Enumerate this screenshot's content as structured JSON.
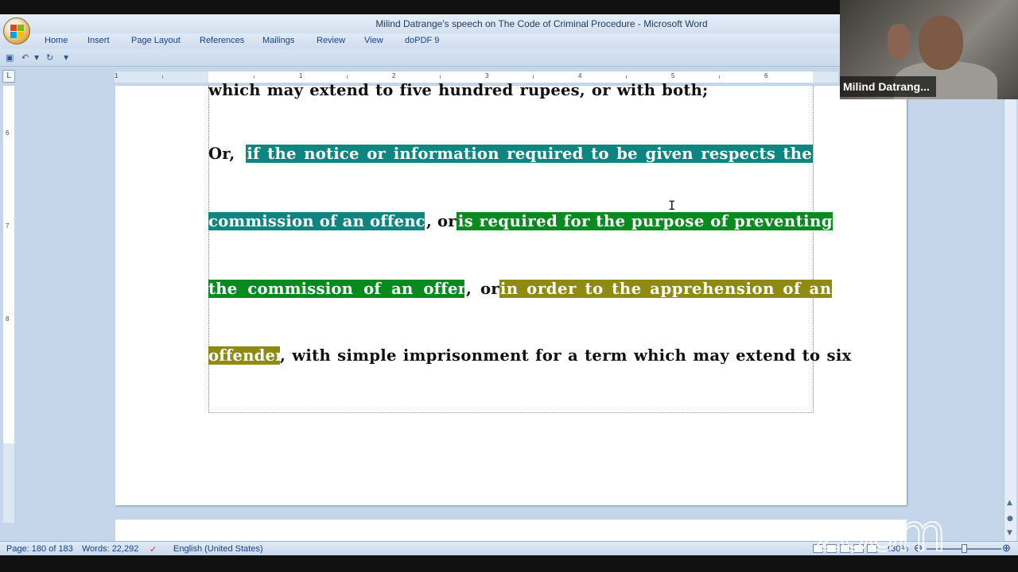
{
  "window": {
    "title": "Milind Datrange's speech on The Code of Criminal Procedure - Microsoft Word"
  },
  "ribbon": {
    "tabs": [
      "Home",
      "Insert",
      "Page Layout",
      "References",
      "Mailings",
      "Review",
      "View",
      "doPDF 9"
    ]
  },
  "ruler": {
    "numbers": [
      "1",
      "1",
      "2",
      "3",
      "4",
      "5",
      "6"
    ],
    "vnumbers": [
      "6",
      "7",
      "8"
    ]
  },
  "document": {
    "line1": "which may extend to five hundred rupees, or with both;",
    "line2_prefix": "Or,",
    "line2_words": [
      "if",
      "the",
      "notice",
      "or",
      "information",
      "required",
      "to",
      "be",
      "given",
      "respects",
      "the"
    ],
    "line3_teal": "commission of an offence",
    "line3_mid": ", or",
    "line3_green": "is required for the purpose of preventing",
    "line4_green": "the commission of an offence",
    "line4_mid": ", or",
    "line4_olive": "in order to the apprehension of an",
    "line5_olive": "offender",
    "line5_rest": ", with simple imprisonment for a term which may extend to six"
  },
  "status": {
    "page": "Page: 180 of 183",
    "words": "Words: 22,292",
    "language": "English (United States)",
    "zoom": "130%"
  },
  "video": {
    "participant": "Milind Datrang..."
  },
  "watermark": "zoom",
  "colors": {
    "teal": "#0f8582",
    "green": "#078b1f",
    "olive": "#8f8b12"
  }
}
